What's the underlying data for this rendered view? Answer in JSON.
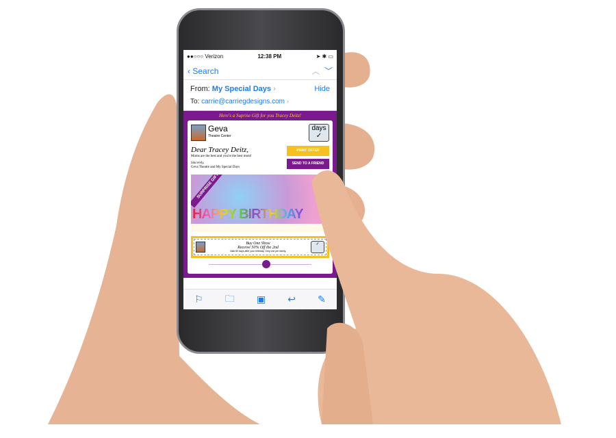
{
  "status": {
    "carrier": "●●○○○ Verizon",
    "time": "12:38 PM",
    "battery": "▮▮▮"
  },
  "nav": {
    "back_label": "Search"
  },
  "header": {
    "from_label": "From:",
    "from_value": "My Special Days",
    "hide_label": "Hide",
    "to_label": "To:",
    "to_value": "carrie@carriegdesigns.com"
  },
  "email": {
    "banner": "Here's a Suprise Gift for you Tracey Deitz!",
    "brand_name": "Geva",
    "brand_sub": "Theatre Center",
    "days_logo": "days",
    "greeting": "Dear Tracey Deitz,",
    "line1": "Moms are the best and you're the best mom!",
    "signoff": "Sincerely,",
    "signature": "Geva Theatre and My Special Days",
    "print_button": "PRINT OFFER",
    "send_button": "SEND TO A FRIEND",
    "ribbon": "SURPRISE GIFT",
    "birthday_text": "HAPPY BIRTHDAY",
    "coupon_line1": "Buy One Show",
    "coupon_line2": "Receive 50% Off the 2nd",
    "coupon_fine": "Valid 60 days after your birthday. Only one per family."
  },
  "colors": {
    "accent": "#1a7cf0",
    "purple": "#7a1a8e",
    "gold": "#f6c020",
    "skin": "#e8b898"
  },
  "toolbar": {
    "icons": [
      "flag-icon",
      "folder-icon",
      "archive-icon",
      "reply-icon",
      "compose-icon"
    ]
  }
}
